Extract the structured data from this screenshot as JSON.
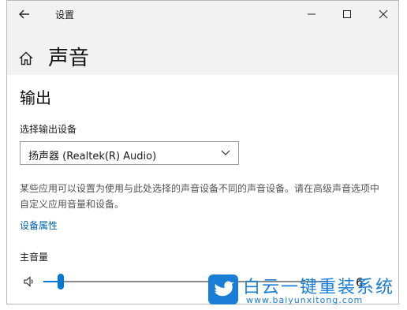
{
  "window": {
    "title": "设置"
  },
  "page": {
    "title": "声音"
  },
  "output": {
    "section_title": "输出",
    "device_label": "选择输出设备",
    "device_value": "扬声器 (Realtek(R) Audio)",
    "description": "某些应用可以设置为使用与此处选择的声音设备不同的声音设备。请在高级声音选项中自定义应用音量和设备。",
    "properties_link": "设备属性",
    "volume_label": "主音量",
    "volume_value": "6",
    "volume_fraction": 0.06
  },
  "watermark": {
    "name": "白云一键重装系统",
    "url": "www.baiyunxitong.com"
  },
  "colors": {
    "accent": "#0078d7",
    "link": "#0063b1",
    "watermark": "#1a7ed6"
  },
  "icons": [
    "back-arrow-icon",
    "minimize-icon",
    "maximize-icon",
    "close-icon",
    "home-icon",
    "chevron-down-icon",
    "speaker-icon",
    "bird-logo-icon"
  ]
}
